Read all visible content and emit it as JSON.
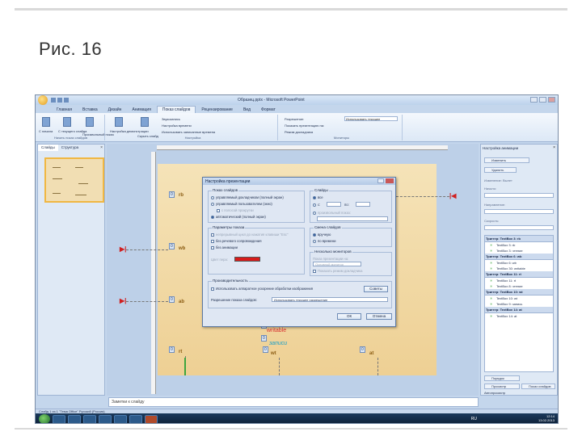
{
  "slide": {
    "title": "Рис. 16"
  },
  "app": {
    "window_title": "Образец.pptx - Microsoft PowerPoint",
    "ribbon_tabs": [
      "Главная",
      "Вставка",
      "Дизайн",
      "Анимация",
      "Показ слайдов",
      "Рецензирование",
      "Вид",
      "Формат"
    ],
    "active_tab": "Показ слайдов",
    "ribbon": {
      "group_start": "Начать показ слайдов",
      "btn_from_start": "С начала",
      "btn_from_current": "С текущего слайда",
      "btn_custom": "Произвольный показ",
      "group_setup": "Настройка",
      "btn_setup": "Настройка демонстрации",
      "btn_hide": "Скрыть слайд",
      "line_record": "Звукозапись",
      "line_rehearse": "Настройка времени",
      "line_timings": "Использовать записанные времена",
      "group_monitors": "Мониторы",
      "line_resolution": "Разрешение:",
      "field_resolution": "Использовать текущее",
      "line_show_on": "Показать презентацию на:",
      "line_presenter": "Режим докладчика"
    }
  },
  "left_pane": {
    "tab_slides": "Слайды",
    "tab_outline": "Структура",
    "close": "×"
  },
  "stage": {
    "labels": [
      "rb",
      "wb",
      "ab",
      "rt",
      "wt",
      "at"
    ],
    "red_text": "writable",
    "blue_text": "записи",
    "tags": [
      "0",
      "0",
      "0",
      "0",
      "0",
      "0",
      "0",
      "0"
    ]
  },
  "notes": {
    "placeholder": "Заметки к слайду"
  },
  "right_pane": {
    "title": "Настройка анимации",
    "close": "×",
    "btn_change": "Изменить",
    "btn_remove": "Удалить",
    "label_change": "Изменение: Вылет",
    "label_start": "Начало:",
    "label_direction": "Направление:",
    "label_speed": "Скорость:",
    "list": [
      {
        "trigger": "Триггер: TextBox 3: rb",
        "items": [
          "TextBox 3: rb",
          "TextBox 3: чтение"
        ]
      },
      {
        "trigger": "Триггер: TextBox 6: wb",
        "items": [
          "TextBox 6: wb",
          "TextBox 30: writable"
        ]
      },
      {
        "trigger": "Триггер: TextBox 11: rt",
        "items": [
          "TextBox 11: rt",
          "TextBox 8: чтение"
        ]
      },
      {
        "trigger": "Триггер: TextBox 10: wt",
        "items": [
          "TextBox 10: wt",
          "TextBox 9: запись"
        ]
      },
      {
        "trigger": "Триггер: TextBox 14: at",
        "items": [
          "TextBox 14: at"
        ]
      }
    ],
    "btn_reorder": "Порядок",
    "btn_play": "Просмотр",
    "btn_show": "Показ слайдов",
    "check_autopreview": "Автопросмотр"
  },
  "status": {
    "text": "Слайд 1 из 1   \"Тема Office\"   Русский (Россия)"
  },
  "taskbar": {
    "lang": "RU",
    "time": "12:14",
    "date": "13.02.2013"
  },
  "dialog": {
    "title": "Настройка презентации",
    "group_show_type": "Показ слайдов",
    "opt_speaker": "управляемый докладчиком (полный экран)",
    "opt_user": "управляемый пользователем (окно)",
    "opt_scrollbar": "с полосой прокрутки",
    "opt_kiosk": "автоматический (полный экран)",
    "group_show_options": "Параметры показа",
    "opt_loop": "непрерывный цикл до нажатия клавиши \"Esc\"",
    "opt_no_narration": "без речевого сопровождения",
    "opt_no_animation": "без анимации",
    "label_pen_color": "Цвет пера:",
    "group_slides": "Слайды",
    "opt_all": "все",
    "opt_from": "с:",
    "opt_to": "по:",
    "opt_custom_show": "произвольный показ:",
    "group_advance": "Смена слайдов",
    "opt_manual": "вручную",
    "opt_timings": "по времени",
    "group_monitors": "Несколько мониторов",
    "label_show_on": "Показ презентации на:",
    "field_primary": "Основной монитор",
    "opt_presenter": "Показать режим докладчика",
    "group_performance": "Производительность",
    "opt_hw_accel": "Использовать аппаратное ускорение обработки изображения",
    "btn_tips": "Советы",
    "label_resolution": "Разрешение показа слайдов:",
    "field_resolution": "Использовать текущее разрешение",
    "btn_ok": "ОК",
    "btn_cancel": "Отмена"
  }
}
